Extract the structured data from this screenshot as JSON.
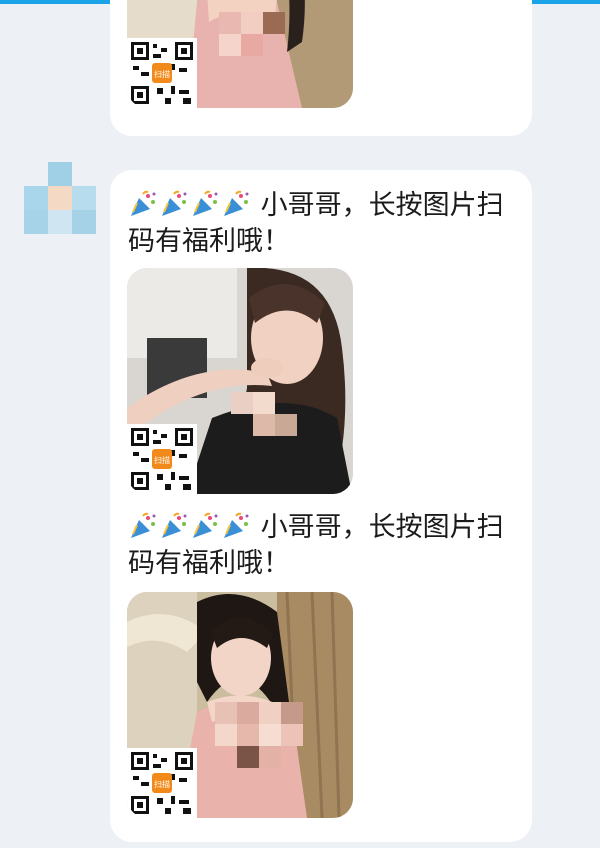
{
  "chat": {
    "messages": [
      {
        "text": "小哥哥，长按图片扫码有福利哦！",
        "party_icons": [
          "party-popper-icon",
          "party-popper-icon",
          "party-popper-icon",
          "party-popper-icon"
        ]
      },
      {
        "text": "小哥哥，长按图片扫码有福利哦！",
        "party_icons": [
          "party-popper-icon",
          "party-popper-icon",
          "party-popper-icon",
          "party-popper-icon"
        ]
      }
    ],
    "qr_badge_label": "扫描"
  },
  "colors": {
    "accent": "#1aa3e6",
    "background": "#edf0f5",
    "bubble": "#ffffff"
  }
}
